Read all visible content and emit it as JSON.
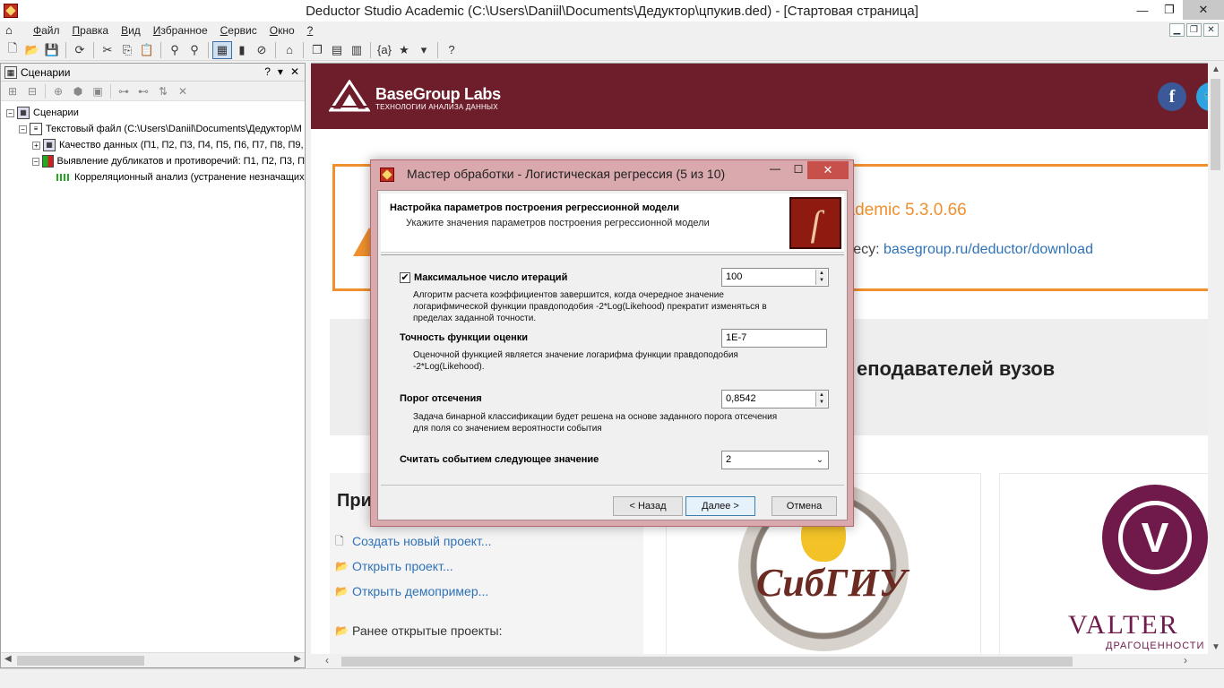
{
  "window": {
    "title": "Deductor Studio Academic (C:\\Users\\Daniil\\Documents\\Дедуктор\\цпукив.ded) - [Стартовая страница]",
    "minimize": "—",
    "maximize": "❐",
    "close": "✕"
  },
  "menu": {
    "items": [
      {
        "underline": "Ф",
        "rest": "айл"
      },
      {
        "underline": "П",
        "rest": "равка"
      },
      {
        "underline": "В",
        "rest": "ид"
      },
      {
        "underline": "И",
        "rest": "збранное"
      },
      {
        "underline": "С",
        "rest": "ервис"
      },
      {
        "underline": "О",
        "rest": "кно"
      },
      {
        "underline": "?",
        "rest": ""
      }
    ]
  },
  "left_panel": {
    "title": "Сценарии",
    "ctrl_help": "?",
    "ctrl_pin": "▾",
    "ctrl_close": "✕",
    "tree": [
      {
        "label": "Сценарии",
        "exp": "−"
      },
      {
        "label": "Текстовый файл (C:\\Users\\Daniil\\Documents\\Дедуктор\\M",
        "exp": "−"
      },
      {
        "label": "Качество данных (П1, П2, П3, П4, П5, П6, П7, П8, П9,",
        "exp": "+"
      },
      {
        "label": "Выявление дубликатов и противоречий: П1, П2, П3, П",
        "exp": "−"
      },
      {
        "label": "Корреляционный анализ (устранение незначащих",
        "exp": ""
      }
    ]
  },
  "start_page": {
    "brand": "BaseGroup Labs",
    "brand_sub": "ТЕХНОЛОГИИ АНАЛИЗА ДАННЫХ",
    "version_text": "cademic 5.3.0.66",
    "download_prefix": "дресу: ",
    "download_link": "basegroup.ru/deductor/download",
    "teachers_text": "еподавателей вузов",
    "actions_title": "При",
    "actions": [
      {
        "label": "Создать новый проект..."
      },
      {
        "label": "Открыть проект..."
      },
      {
        "label": "Открыть демопример..."
      }
    ],
    "recent_label": "Ранее открытые проекты:",
    "partner1_text": "СибГИУ",
    "partner2_name": "VALTER",
    "partner2_sub": "ДРАГОЦЕННОСТИ"
  },
  "dialog": {
    "title": "Мастер обработки - Логистическая регрессия (5 из 10)",
    "close": "✕",
    "header_title": "Настройка параметров построения регрессионной модели",
    "header_sub": "Укажите значения параметров построения регрессионной модели",
    "max_iter": {
      "label": "Максимальное число итераций",
      "checked": true,
      "value": "100",
      "desc": "Алгоритм расчета коэффициентов завершится, когда очередное значение логарифмической функции правдоподобия -2*Log(Likehood) прекратит изменяться в пределах заданной точности."
    },
    "precision": {
      "label": "Точность функции оценки",
      "value": "1E-7",
      "desc": "Оценочной функцией является значение логарифма функции правдоподобия -2*Log(Likehood)."
    },
    "threshold": {
      "label": "Порог отсечения",
      "value": "0,8542",
      "desc": "Задача бинарной классификации будет решена на основе заданного порога отсечения для поля со значением вероятности события"
    },
    "event_value": {
      "label": "Считать событием следующее значение",
      "value": "2"
    },
    "buttons": {
      "back": "< Назад",
      "next": "Далее >",
      "cancel": "Отмена"
    }
  },
  "colors": {
    "header_bg": "#6d1e2a",
    "accent_orange": "#f0902e",
    "link_blue": "#2f72b8",
    "dialog_frame": "#d9a9ad",
    "dialog_close": "#c7504a"
  }
}
